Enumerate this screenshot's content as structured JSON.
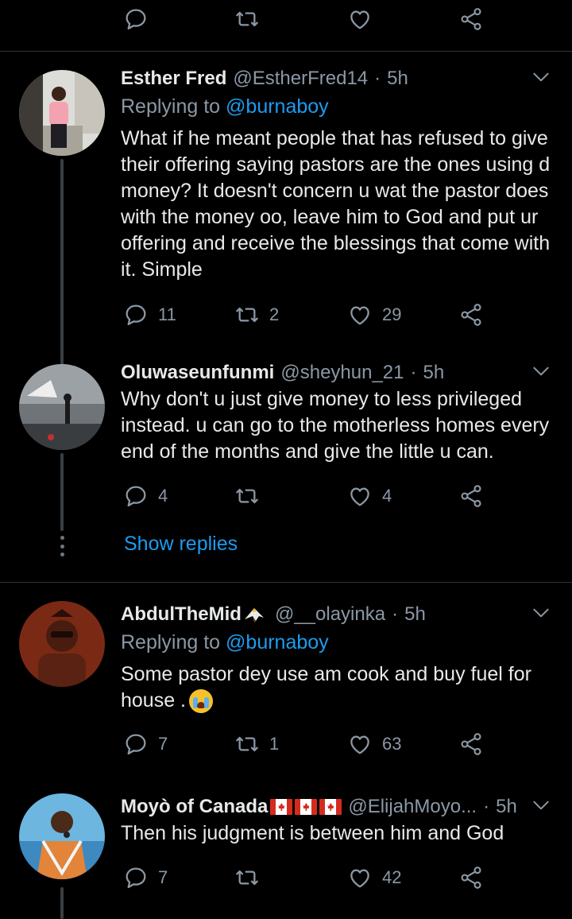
{
  "tweets": [
    {
      "name": "Esther Fred",
      "handle": "@EstherFred14",
      "time": "5h",
      "replying_prefix": "Replying to",
      "replying_to": "@burnaboy",
      "text_lines": [
        "What if he meant people that has refused to give",
        "their offering saying pastors are the ones using d",
        "money? It doesn't concern u wat the pastor does",
        "with the money oo, leave him to God and put ur",
        "offering and receive the blessings that come with",
        "it. Simple"
      ],
      "replies": "11",
      "retweets": "2",
      "likes": "29"
    },
    {
      "name": "Oluwaseunfunmi",
      "handle": "@sheyhun_21",
      "time": "5h",
      "text_lines": [
        "Why don't u just give money to less privileged",
        "instead.  u can go to the motherless homes every",
        "end of the months and give the little u can."
      ],
      "replies": "4",
      "retweets": "",
      "likes": "4"
    },
    {
      "name": "AbdulTheMid",
      "handle": "@__olayinka",
      "time": "5h",
      "replying_prefix": "Replying to",
      "replying_to": "@burnaboy",
      "text_lines": [
        "Some pastor dey use am cook and buy fuel for",
        "house ."
      ],
      "replies": "7",
      "retweets": "1",
      "likes": "63"
    },
    {
      "name": "Moyò of Canada",
      "handle": "@ElijahMoyo...",
      "time": "5h",
      "text_lines": [
        "Then his judgment is between him and God"
      ],
      "replies": "7",
      "retweets": "",
      "likes": "42"
    }
  ],
  "show_replies": "Show replies",
  "dot_separator": "·",
  "colors": {
    "background": "#000000",
    "link": "#1d9bf0",
    "muted": "#8b98a5",
    "text": "#e7e9ea"
  },
  "icons": [
    "reply-icon",
    "retweet-icon",
    "like-icon",
    "share-icon",
    "chevron-down-icon",
    "eagle-emoji-icon",
    "canada-flag-icon",
    "crying-face-emoji-icon"
  ]
}
